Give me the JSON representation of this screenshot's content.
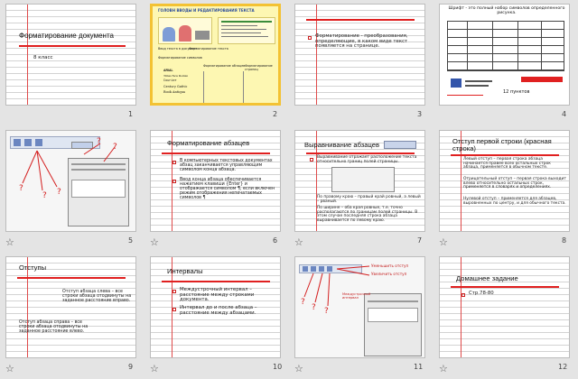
{
  "slides": [
    {
      "num": "1",
      "title": "Форматирование документа",
      "sub": "8 класс"
    },
    {
      "num": "2",
      "title": "ГОЛОВН ВВОДЫ И РЕДАКТИРОВАНИЯ ТЕКСТА",
      "sections": [
        "Ввод текста в документ",
        "Форматирование текста",
        "Форматирование символов",
        "Форматирование абзацев",
        "Форматирование страниц"
      ],
      "fontlist": [
        "ARIAL",
        "Times New Roman",
        "Courier",
        "Century Gothic",
        "Book Antiqua"
      ]
    },
    {
      "num": "3",
      "text": "Форматирование - преобразования, определяющие, в каком виде текст появляется на странице."
    },
    {
      "num": "4",
      "title": "Шрифт - это полный набор символов определенного рисунка.",
      "note": "12 пунктов"
    },
    {
      "num": "5"
    },
    {
      "num": "6",
      "title": "Форматирование абзацев",
      "p1": "В компьютерных текстовых документах абзац заканчивается управляющим символом конца абзаца.",
      "p2": "Ввод конца абзаца обеспечивается нажатием клавиши {Enter} и отображается символом ¶, если включен режим отображения непечатаемых символов ¶"
    },
    {
      "num": "7",
      "title": "Выравнивание абзацев",
      "p1": "Выравнивание отражает расположение текста относительно границ полей страницы.",
      "p2": "По правому краю – правый край ровный, а левый – рваный.",
      "p3": "По ширине – оба края ровные, т.е. точно располагаются по границам полей страницы. В этом случае последняя строка абзаца выравнивается по левому краю."
    },
    {
      "num": "8",
      "title": "Отступ первой строки (красная строка)",
      "p1": "Левый отступ – первая строка абзаца начинается правее всех остальных строк абзаца, применяется в обычном тексте.",
      "p2": "Отрицательный отступ – первая строка выходит влево относительно остальных строк, применяется в словарях и определениях.",
      "p3": "Нулевой отступ – применяется для абзацев, выровненных по центру, и для обычного текста."
    },
    {
      "num": "9",
      "title": "Отступы",
      "p1": "Отступ абзаца слева – все строки абзаца отодвинуты на заданное расстояние вправо.",
      "p2": "Отступ абзаца справа – все строки абзаца отодвинуты на заданное расстояние влево."
    },
    {
      "num": "10",
      "title": "Интервалы",
      "p1": "Междустрочный интервал – расстояние между строками документа.",
      "p2": "Интервал до и после абзаца – расстояние между абзацами."
    },
    {
      "num": "11",
      "l1": "Уменьшить отступ",
      "l2": "Увеличить отступ",
      "l3": "Междустрочный интервал"
    },
    {
      "num": "12",
      "title": "Домашнее задание",
      "p1": "Стр.78-80"
    }
  ],
  "colors": {
    "accent": "#e02020",
    "selection": "#f3c233",
    "lines": "#d3d3d3"
  }
}
